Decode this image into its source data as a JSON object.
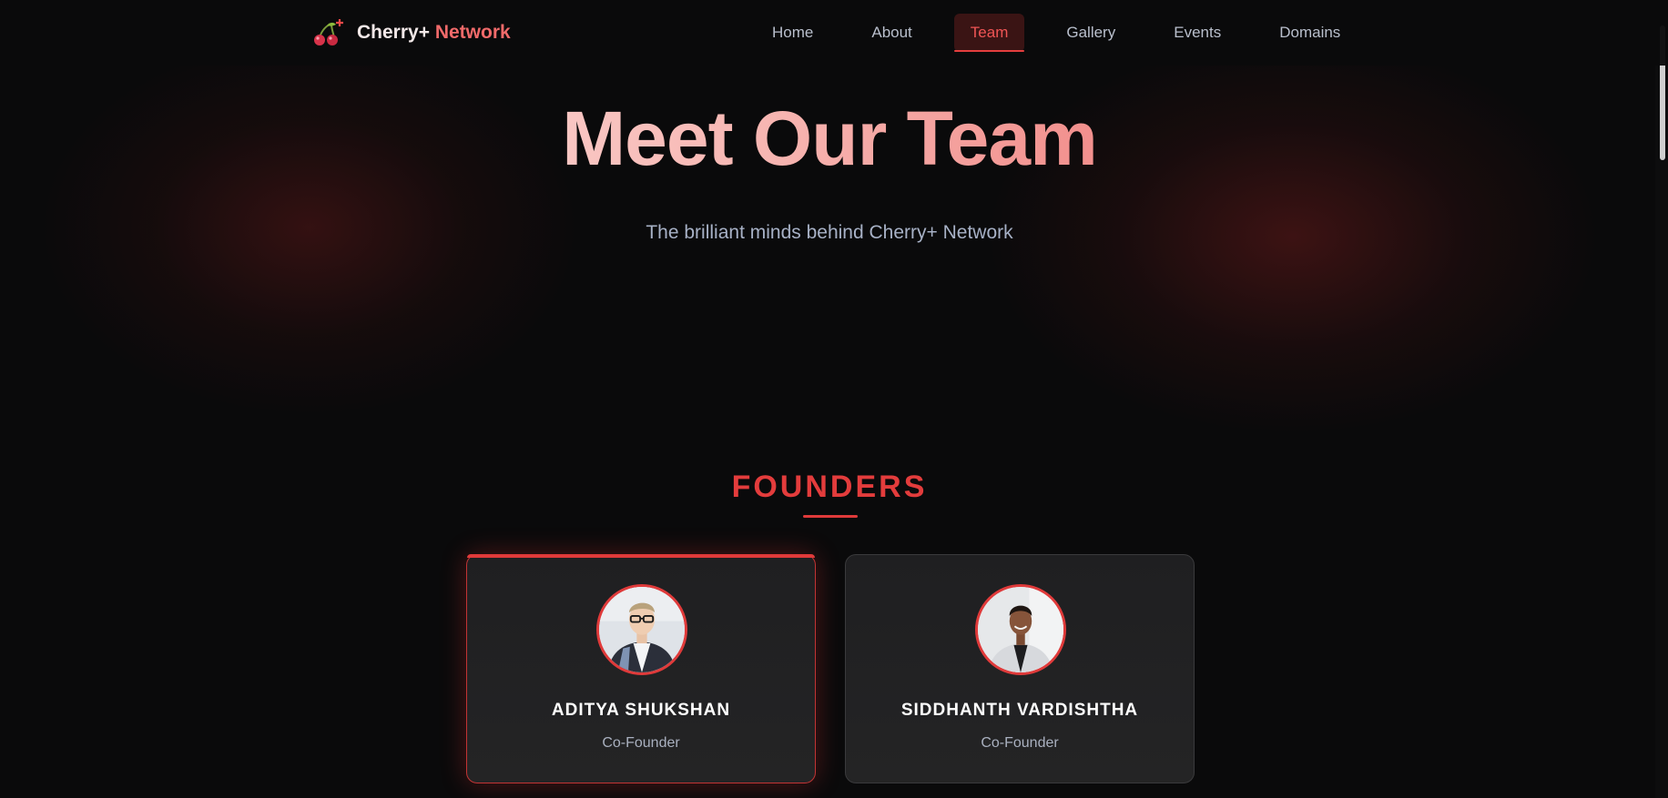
{
  "brand": {
    "name_part1": "Cherry+",
    "name_part2": "Network",
    "logo_icon": "cherry-icon"
  },
  "nav": {
    "items": [
      {
        "label": "Home",
        "active": false
      },
      {
        "label": "About",
        "active": false
      },
      {
        "label": "Team",
        "active": true
      },
      {
        "label": "Gallery",
        "active": false
      },
      {
        "label": "Events",
        "active": false
      },
      {
        "label": "Domains",
        "active": false
      }
    ]
  },
  "hero": {
    "title": "Meet Our Team",
    "subtitle": "The brilliant minds behind Cherry+ Network"
  },
  "founders": {
    "heading": "FOUNDERS",
    "members": [
      {
        "name": "ADITYA SHUKSHAN",
        "role": "Co-Founder"
      },
      {
        "name": "SIDDHANTH VARDISHTHA",
        "role": "Co-Founder"
      }
    ]
  },
  "colors": {
    "accent": "#e53e3e",
    "background": "#0a0a0b",
    "card": "#222224",
    "muted_text": "#a9b0bf"
  }
}
